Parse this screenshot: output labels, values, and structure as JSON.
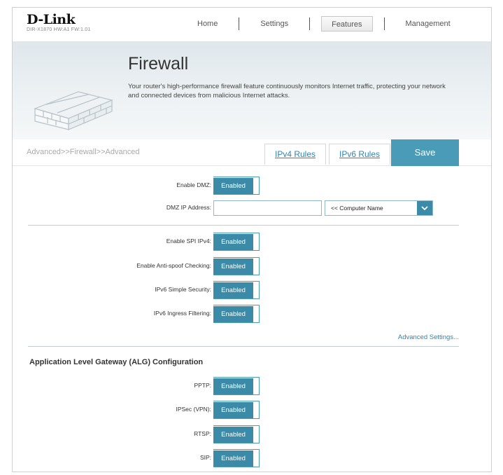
{
  "header": {
    "brand": "D-Link",
    "hw_info": "DIR-X1870 HW:A1 FW:1.01",
    "nav": [
      {
        "label": "Home"
      },
      {
        "label": "Settings"
      },
      {
        "label": "Features"
      },
      {
        "label": "Management"
      }
    ],
    "active_nav": "Features"
  },
  "banner": {
    "title": "Firewall",
    "description": "Your router's high-performance firewall feature continuously monitors Internet traffic, protecting your network and connected devices from malicious Internet attacks."
  },
  "subnav": {
    "breadcrumb": "Advanced>>Firewall>>Advanced",
    "tab_ipv4": "IPv4 Rules",
    "tab_ipv6": "IPv6 Rules",
    "save_label": "Save"
  },
  "dmz": {
    "enable_label": "Enable DMZ:",
    "enable_state": "Enabled",
    "ip_label": "DMZ IP Address:",
    "ip_value": "",
    "computer_select": "<< Computer Name"
  },
  "security": {
    "spi_label": "Enable SPI IPv4:",
    "spi_state": "Enabled",
    "antispoof_label": "Enable Anti-spoof Checking:",
    "antispoof_state": "Enabled",
    "ipv6_simple_label": "IPv6 Simple Security:",
    "ipv6_simple_state": "Enabled",
    "ipv6_ingress_label": "IPv6 Ingress Filtering:",
    "ipv6_ingress_state": "Enabled",
    "advanced_link": "Advanced Settings..."
  },
  "alg": {
    "title": "Application Level Gateway (ALG) Configuration",
    "pptp_label": "PPTP:",
    "pptp_state": "Enabled",
    "ipsec_label": "IPSec (VPN):",
    "ipsec_state": "Enabled",
    "rtsp_label": "RTSP:",
    "rtsp_state": "Enabled",
    "sip_label": "SIP:",
    "sip_state": "Enabled"
  },
  "colors": {
    "accent": "#3a8aa8",
    "link": "#2d84b2",
    "save": "#4a9bb7"
  }
}
